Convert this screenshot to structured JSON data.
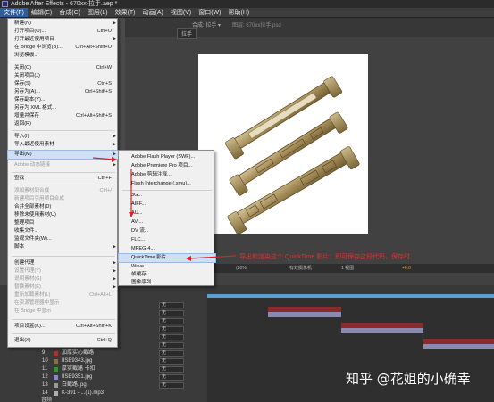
{
  "window": {
    "title": "Adobe After Effects - 670xx-拉手.aep *"
  },
  "menubar": [
    "文件(F)",
    "编辑(E)",
    "合成(C)",
    "图层(L)",
    "效果(T)",
    "动画(A)",
    "视图(V)",
    "窗口(W)",
    "帮助(H)"
  ],
  "comp_tabs": {
    "tab1": "拉手",
    "tab2": "合成: 拉手 ▾",
    "tab3": "图层: 670xx拉手.psd"
  },
  "file_menu": [
    {
      "label": "新建(N)",
      "shortcut": "",
      "submenu": true,
      "disabled": false
    },
    {
      "label": "打开项目(O)...",
      "shortcut": "Ctrl+O",
      "submenu": false,
      "disabled": false
    },
    {
      "label": "打开最近使用项目",
      "shortcut": "",
      "submenu": true,
      "disabled": false
    },
    {
      "label": "在 Bridge 中浏览(B)...",
      "shortcut": "Ctrl+Alt+Shift+O",
      "submenu": false,
      "disabled": false
    },
    {
      "label": "浏览模板...",
      "shortcut": "",
      "submenu": false,
      "disabled": false
    },
    {
      "label": "关闭(C)",
      "shortcut": "Ctrl+W",
      "submenu": false,
      "disabled": false
    },
    {
      "label": "关闭项目(J)",
      "shortcut": "",
      "submenu": false,
      "disabled": false
    },
    {
      "label": "保存(S)",
      "shortcut": "Ctrl+S",
      "submenu": false,
      "disabled": false
    },
    {
      "label": "另存为(A)...",
      "shortcut": "Ctrl+Shift+S",
      "submenu": false,
      "disabled": false
    },
    {
      "label": "保存副本(Y)...",
      "shortcut": "",
      "submenu": false,
      "disabled": false
    },
    {
      "label": "另存为 XML 格式...",
      "shortcut": "",
      "submenu": false,
      "disabled": false
    },
    {
      "label": "增量并保存",
      "shortcut": "Ctrl+Alt+Shift+S",
      "submenu": false,
      "disabled": false
    },
    {
      "label": "返回(R)",
      "shortcut": "",
      "submenu": false,
      "disabled": false
    },
    {
      "label": "导入(I)",
      "shortcut": "",
      "submenu": true,
      "disabled": false
    },
    {
      "label": "导入最近使用素材",
      "shortcut": "",
      "submenu": true,
      "disabled": false
    },
    {
      "label": "导出(M)",
      "shortcut": "",
      "submenu": true,
      "disabled": false
    },
    {
      "label": "Adobe 动态链接",
      "shortcut": "",
      "submenu": true,
      "disabled": true
    },
    {
      "label": "查找",
      "shortcut": "Ctrl+F",
      "submenu": false,
      "disabled": false
    },
    {
      "label": "添加素材到合成",
      "shortcut": "Ctrl+/",
      "submenu": false,
      "disabled": true
    },
    {
      "label": "新建项目引用项目合成",
      "shortcut": "",
      "submenu": false,
      "disabled": true
    },
    {
      "label": "合并全部素材(D)",
      "shortcut": "",
      "submenu": false,
      "disabled": false
    },
    {
      "label": "移除未使用素材(U)",
      "shortcut": "",
      "submenu": false,
      "disabled": false
    },
    {
      "label": "整理项目",
      "shortcut": "",
      "submenu": false,
      "disabled": false
    },
    {
      "label": "收集文件...",
      "shortcut": "",
      "submenu": false,
      "disabled": false
    },
    {
      "label": "监视文件夹(W)...",
      "shortcut": "",
      "submenu": false,
      "disabled": false
    },
    {
      "label": "脚本",
      "shortcut": "",
      "submenu": true,
      "disabled": false
    },
    {
      "label": "创建代理",
      "shortcut": "",
      "submenu": true,
      "disabled": false
    },
    {
      "label": "设置代理(Y)",
      "shortcut": "",
      "submenu": true,
      "disabled": true
    },
    {
      "label": "说明素材(G)",
      "shortcut": "",
      "submenu": true,
      "disabled": true
    },
    {
      "label": "替换素材(E)",
      "shortcut": "",
      "submenu": true,
      "disabled": true
    },
    {
      "label": "重新加载素材(L)",
      "shortcut": "Ctrl+Alt+L",
      "submenu": false,
      "disabled": true
    },
    {
      "label": "在资源管理器中显示",
      "shortcut": "",
      "submenu": false,
      "disabled": true
    },
    {
      "label": "在 Bridge 中显示",
      "shortcut": "",
      "submenu": false,
      "disabled": true
    },
    {
      "label": "项目设置(K)...",
      "shortcut": "Ctrl+Alt+Shift+K",
      "submenu": false,
      "disabled": false
    },
    {
      "label": "退出(X)",
      "shortcut": "Ctrl+Q",
      "submenu": false,
      "disabled": false
    }
  ],
  "export_menu": [
    "Adobe Flash Player (SWF)...",
    "Adobe Premiere Pro 项目...",
    "Adobe 剪辑注释...",
    "Flash Interchange (.xmu)...",
    "3G...",
    "AIFF...",
    "AU...",
    "AVI...",
    "DV 流...",
    "FLC...",
    "MPEG-4...",
    "QuickTime 影片...",
    "Wave...",
    "帧缓存...",
    "图像序列..."
  ],
  "annotation": "导出和渲染这个 QuickTime 影片：即可保存这段代码，保存时...",
  "layers": [
    {
      "num": "9",
      "name": "加厚实心截路",
      "color": "#b03030"
    },
    {
      "num": "10",
      "name": "IISB9343.jpg",
      "color": "#8a7040"
    },
    {
      "num": "11",
      "name": "厚实截路 卡扣",
      "color": "#2a9a2a"
    },
    {
      "num": "12",
      "name": "IISB9351.jpg",
      "color": "#8a8ad0"
    },
    {
      "num": "13",
      "name": "白截路.jpg",
      "color": "#9a9a9a"
    },
    {
      "num": "14",
      "name": "K-391 - ...(1).mp3",
      "color": "#b0b0b0"
    }
  ],
  "layer_mode": "无",
  "comp_footer": {
    "zoom": "(20%)",
    "view": "有效摄像机",
    "views": "1 视图",
    "exposure": "+0.0"
  },
  "bottom_label": "音频",
  "watermark": "知乎 @花姐的小确幸",
  "colors": {
    "menubar_active": "#2f5d9a",
    "menu_bg": "#f0f0f0",
    "highlight": "#cfe0f5",
    "annotation": "#e03030"
  }
}
